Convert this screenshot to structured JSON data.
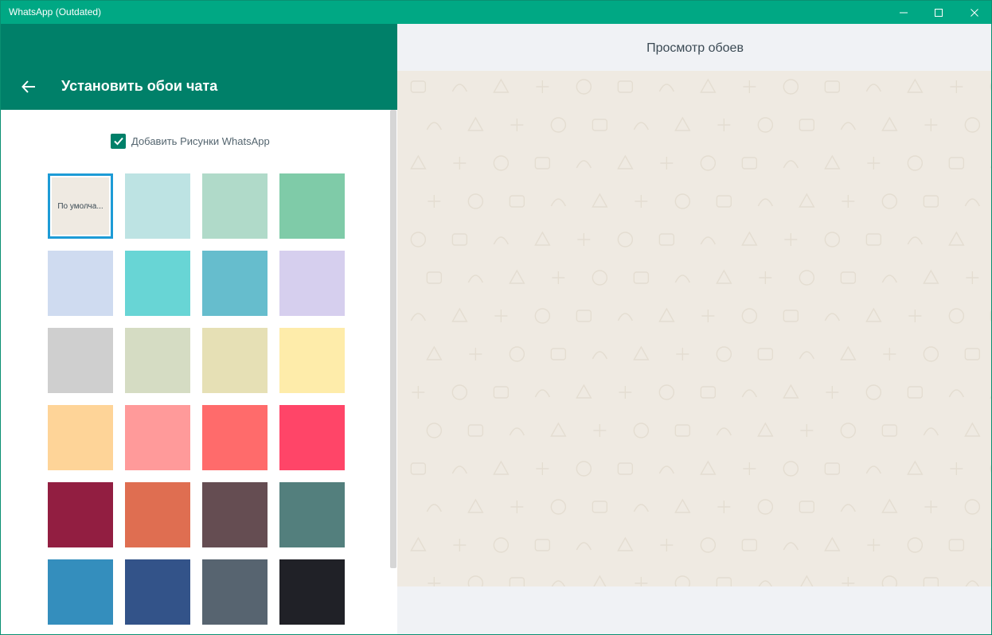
{
  "window": {
    "title": "WhatsApp (Outdated)",
    "titlebar_color": "#00a884",
    "controls": [
      "minimize-icon",
      "maximize-icon",
      "close-icon"
    ]
  },
  "left_panel": {
    "header_title": "Установить обои чата",
    "header_color": "#008069",
    "back_icon": "arrow-left-icon",
    "checkbox": {
      "label": "Добавить Рисунки WhatsApp",
      "checked": true
    },
    "swatches": [
      {
        "color": "#efeae2",
        "label": "По умолча...",
        "selected": true
      },
      {
        "color": "#bde3e3"
      },
      {
        "color": "#b0dac9"
      },
      {
        "color": "#7fcba8"
      },
      {
        "color": "#cfdbf0"
      },
      {
        "color": "#68d5d5"
      },
      {
        "color": "#66bdcd"
      },
      {
        "color": "#d6cfee"
      },
      {
        "color": "#cfcfcf"
      },
      {
        "color": "#d5dcc3"
      },
      {
        "color": "#e6e0b5"
      },
      {
        "color": "#feecaa"
      },
      {
        "color": "#fed498"
      },
      {
        "color": "#ff9a9a"
      },
      {
        "color": "#ff6b6b"
      },
      {
        "color": "#ff4568"
      },
      {
        "color": "#921e41"
      },
      {
        "color": "#df6e51"
      },
      {
        "color": "#654d52"
      },
      {
        "color": "#537f7d"
      },
      {
        "color": "#348ebd"
      },
      {
        "color": "#335389"
      },
      {
        "color": "#576470"
      },
      {
        "color": "#202127"
      }
    ]
  },
  "right_panel": {
    "title": "Просмотр обоев",
    "preview_color": "#efeae2",
    "background_color": "#f0f2f5"
  }
}
